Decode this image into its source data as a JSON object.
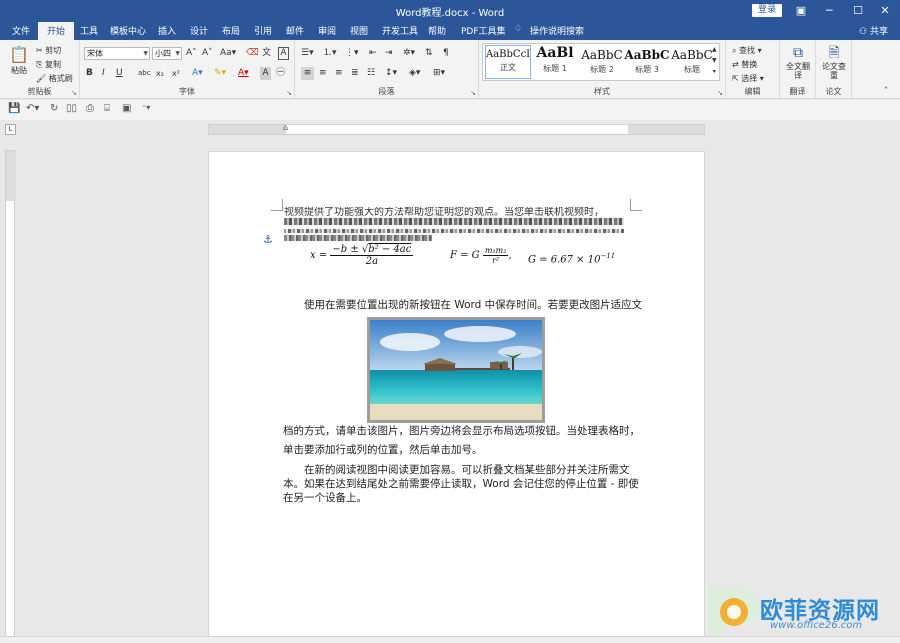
{
  "window": {
    "title": "Word教程.docx  -  Word",
    "login_label": "登录"
  },
  "tabs": [
    "文件",
    "开始",
    "工具",
    "模板中心",
    "插入",
    "设计",
    "布局",
    "引用",
    "邮件",
    "审阅",
    "视图",
    "开发工具",
    "帮助",
    "PDF工具集",
    "操作说明搜索"
  ],
  "share_label": "共享",
  "ribbon": {
    "clipboard": {
      "paste": "粘贴",
      "cut": "剪切",
      "copy": "复制",
      "format_painter": "格式刷",
      "label": "剪贴板"
    },
    "font": {
      "font_name": "宋体",
      "font_size": "小四",
      "label": "字体"
    },
    "paragraph": {
      "label": "段落"
    },
    "styles": {
      "label": "样式",
      "items": [
        {
          "sample": "AaBbCcI",
          "name": "正文"
        },
        {
          "sample": "AaBl",
          "name": "标题 1"
        },
        {
          "sample": "AaBbC",
          "name": "标题 2"
        },
        {
          "sample": "AaBbC",
          "name": "标题 3"
        },
        {
          "sample": "AaBbC",
          "name": "标题"
        }
      ]
    },
    "editing": {
      "find": "查找",
      "replace": "替换",
      "select": "选择",
      "label": "编辑"
    },
    "translate": {
      "button": "全文翻译",
      "label": "翻译"
    },
    "paper": {
      "button": "论文查重",
      "label": "论文"
    }
  },
  "document": {
    "overlap_line": "视频提供了功能强大的方法帮助您证明您的观点。当您单击联机视频时，",
    "equations": {
      "eq1": "x = (−b ± √(b² − 4ac)) / 2a",
      "eq2": "F = G m₁m₂ / r²",
      "eq3": "G = 6.67 × 10⁻¹¹"
    },
    "para1": "使用在需要位置出现的新按钮在 Word 中保存时间。若要更改图片适应文",
    "para1_cont": "档的方式，请单击该图片，图片旁边将会显示布局选项按钮。当处理表格时，",
    "para1_end": "单击要添加行或列的位置，然后单击加号。",
    "para2_l1": "在新的阅读视图中阅读更加容易。可以折叠文档某些部分并关注所需文",
    "para2_l2": "本。如果在达到结尾处之前需要停止读取，Word 会记住您的停止位置 - 即使",
    "para2_l3": "在另一个设备上。"
  },
  "watermark": {
    "text": "欧菲资源网",
    "url": "www.office26.com"
  }
}
